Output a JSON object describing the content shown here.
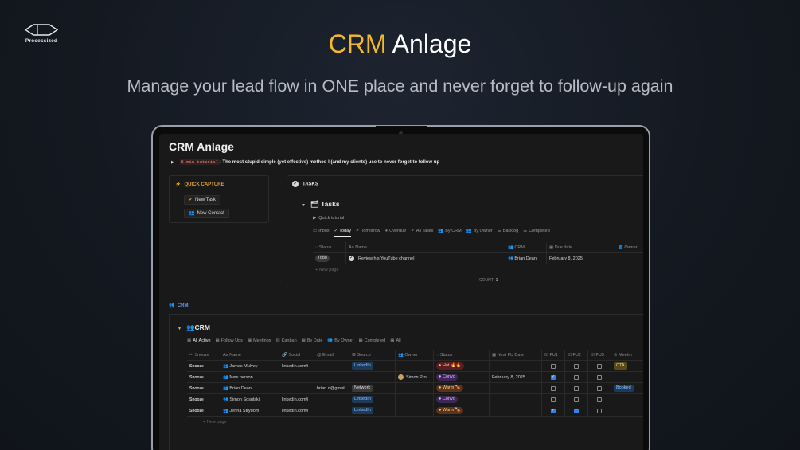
{
  "brand": {
    "name": "Processized",
    "icon": "hexagon-logo-icon"
  },
  "hero": {
    "title_accent": "CRM",
    "title_rest": "Anlage",
    "subtitle": "Manage your lead flow in ONE place and never forget to follow-up again"
  },
  "app": {
    "page_title": "CRM Anlage",
    "tutorial": {
      "code": "5-min tutorial",
      "sep": ":",
      "text": "The most stupid-simple (yet effective) method I (and my clients) use to never forget to follow up"
    },
    "quick_capture": {
      "heading": "QUICK CAPTURE",
      "buttons": [
        {
          "label": "New Task"
        },
        {
          "label": "New Contact"
        }
      ]
    },
    "tasks": {
      "heading": "TASKS",
      "db_title": "Tasks",
      "toggle": "Quick tutorial",
      "tabs": [
        "Inbox",
        "Today",
        "Tomorrow",
        "Overdue",
        "All Tasks",
        "By CRM",
        "By Owner",
        "Backlog",
        "Completed"
      ],
      "active_tab": "Today",
      "columns": [
        "Status",
        "Name",
        "CRM",
        "Due date",
        "Owner"
      ],
      "rows": [
        {
          "status": "Todo",
          "name": "Review his YouTube channel",
          "crm": "Brian Dean",
          "due": "February 8, 2025"
        }
      ],
      "new_page": "New page",
      "count_label": "COUNT",
      "count_value": "1"
    },
    "crm": {
      "heading": "CRM",
      "db_title": "CRM",
      "tabs": [
        "All Active",
        "Follow Ups",
        "Meetings",
        "Kanban",
        "By Date",
        "By Owner",
        "Completed",
        "All"
      ],
      "active_tab": "All Active",
      "columns": [
        "Snooze",
        "Name",
        "Social",
        "Email",
        "Source",
        "Owner",
        "Status",
        "Next FU Date",
        "FU1",
        "FU2",
        "FU3",
        "Meetin"
      ],
      "rows": [
        {
          "snooze": "Snooze",
          "name": "James Mulvey",
          "social": "linkedin.com/i",
          "email": "",
          "source": "LinkedIn",
          "owner": "",
          "status": "Hot 🔥🔥",
          "next": "",
          "fu1": false,
          "fu2": false,
          "fu3": false,
          "meeting": "CTA"
        },
        {
          "snooze": "Snooze",
          "name": "New person",
          "social": "",
          "email": "",
          "source": "",
          "owner": "Simon Pro",
          "status": "Convo",
          "next": "February 8, 2025",
          "fu1": true,
          "fu2": false,
          "fu3": false,
          "meeting": ""
        },
        {
          "snooze": "Snooze",
          "name": "Brian Dean",
          "social": "",
          "email": "brian.d@gmail",
          "source": "Network",
          "owner": "",
          "status": "Warm 🍗",
          "next": "",
          "fu1": false,
          "fu2": false,
          "fu3": false,
          "meeting": "Booked"
        },
        {
          "snooze": "Snooze",
          "name": "Simon Sosulski",
          "social": "linkedin.com/i",
          "email": "",
          "source": "LinkedIn",
          "owner": "",
          "status": "Convo",
          "next": "",
          "fu1": false,
          "fu2": false,
          "fu3": false,
          "meeting": ""
        },
        {
          "snooze": "Snooze",
          "name": "Jenna Strydom",
          "social": "linkedin.com/i",
          "email": "",
          "source": "LinkedIn",
          "owner": "",
          "status": "Warm 🍗",
          "next": "",
          "fu1": true,
          "fu2": true,
          "fu3": false,
          "meeting": ""
        }
      ],
      "new_page": "New page"
    }
  },
  "colors": {
    "accent": "#f5b828",
    "quick_capture": "#e0a13c",
    "crm_heading": "#5aa0ff",
    "checkbox_on": "#2f80ed"
  }
}
